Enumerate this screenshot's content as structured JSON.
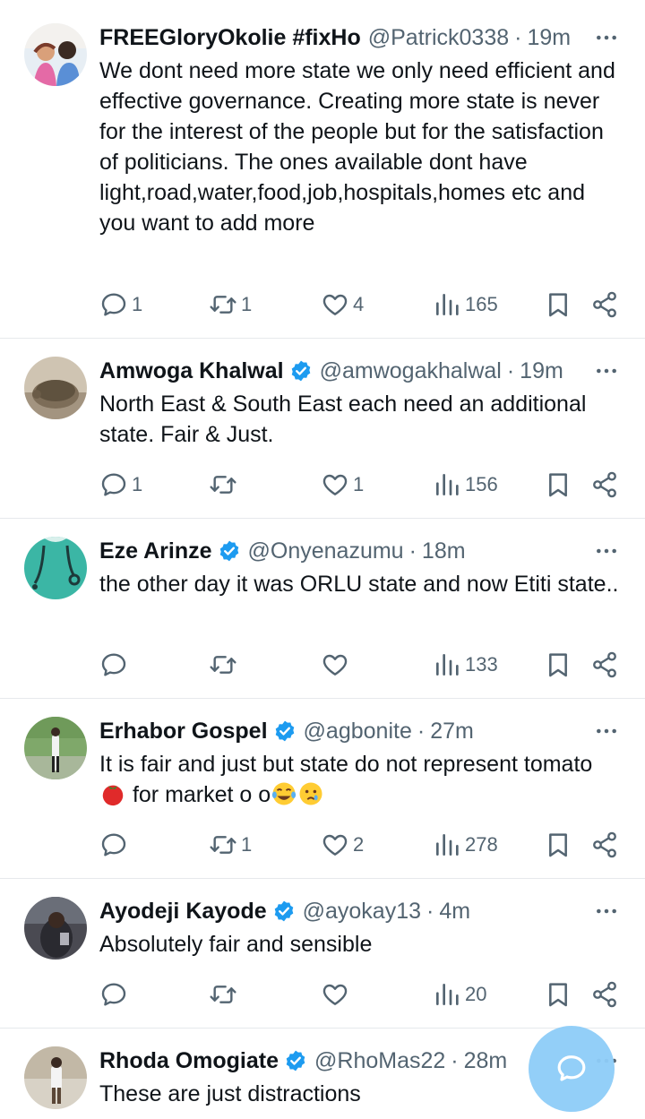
{
  "tweets": [
    {
      "name": "FREEGloryOkolie #fixHo",
      "verified": false,
      "handle": "@Patrick0338",
      "sep": "·",
      "time": "19m",
      "text": "We dont need more state we only need efficient and effective governance. Creating more state is never for the interest of the people but for the satisfaction of politicians.  The ones available dont have light,road,water,food,job,hospitals,homes etc and you want to add more",
      "replies": "1",
      "retweets": "1",
      "likes": "4",
      "views": "165"
    },
    {
      "name": "Amwoga Khalwal",
      "verified": true,
      "handle": "@amwogakhalwal",
      "sep": "·",
      "time": "19m",
      "text": "North East & South East each  need an additional state. Fair & Just.",
      "replies": "1",
      "retweets": "",
      "likes": "1",
      "views": "156"
    },
    {
      "name": "Eze Arinze",
      "verified": true,
      "handle": "@Onyenazumu",
      "sep": "·",
      "time": "18m",
      "text": "the other day it was ORLU state and now Etiti state..",
      "replies": "",
      "retweets": "",
      "likes": "",
      "views": "133"
    },
    {
      "name": "Erhabor Gospel",
      "verified": true,
      "handle": "@agbonite",
      "sep": "·",
      "time": "27m",
      "text_a": "It is fair and just but state do not represent tomato",
      "text_b": "for market o o",
      "replies": "",
      "retweets": "1",
      "likes": "2",
      "views": "278"
    },
    {
      "name": "Ayodeji Kayode",
      "verified": true,
      "handle": "@ayokay13",
      "sep": "·",
      "time": "4m",
      "text": "Absolutely fair and sensible",
      "replies": "",
      "retweets": "",
      "likes": "",
      "views": "20"
    },
    {
      "name": "Rhoda Omogiate",
      "verified": true,
      "handle": "@RhoMas22",
      "sep": "·",
      "time": "28m",
      "text": "These are just distractions"
    }
  ],
  "icons": {
    "reply": "speech-bubble-icon",
    "retweet": "retweet-arrows-icon",
    "like": "heart-icon",
    "views": "bar-chart-icon",
    "bookmark": "bookmark-icon",
    "share": "share-icon",
    "more": "ellipsis-icon",
    "verified": "verified-badge-icon",
    "compose": "new-message-icon"
  },
  "colors": {
    "accent": "#1d9bf0",
    "secondary_text": "#536471",
    "fab": "#8ecdf8"
  }
}
